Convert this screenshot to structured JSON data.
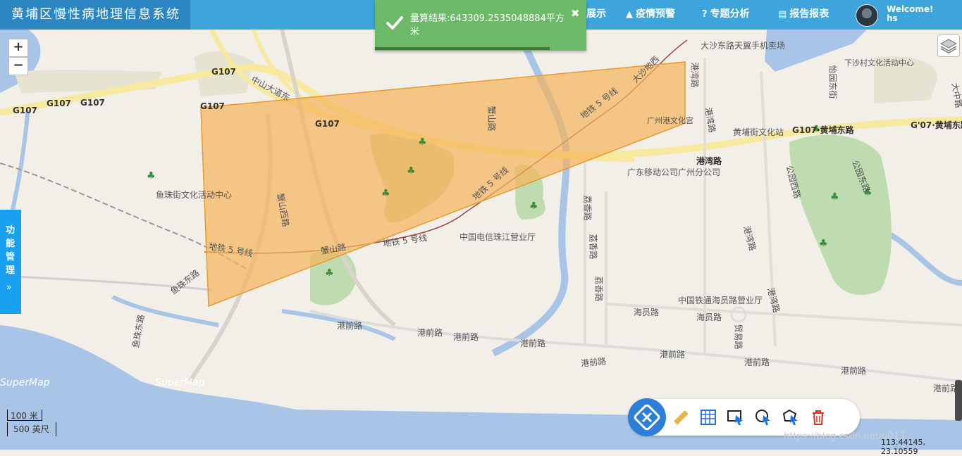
{
  "app": {
    "title": "黄埔区慢性病地理信息系统"
  },
  "nav": {
    "items": [
      {
        "label": "展示",
        "icon": "map-icon"
      },
      {
        "label": "疫情预警",
        "icon": "warning-icon"
      },
      {
        "label": "专题分析",
        "icon": "question-circle-icon"
      },
      {
        "label": "报告报表",
        "icon": "list-icon"
      }
    ],
    "welcome": "Welcome!",
    "user": "hs"
  },
  "notification": {
    "message": "量算结果:643309.2535048884平方米"
  },
  "side_panel": {
    "label": "功能管理",
    "arrow": "»"
  },
  "scale": {
    "metric": "100 米",
    "imperial": "500 英尺"
  },
  "status": {
    "coordinates": "113.44145, 23.10559",
    "watermark": "https://blog.csdn.net/u013..."
  },
  "map_labels": {
    "g107_a": "G107",
    "g107_b": "G107",
    "g107_c": "G107",
    "g107_d": "G107",
    "g107_e": "G107",
    "g107_f": "G107",
    "g107_huangpu": "G'07·黄埔东路",
    "g107_huangpu2": "G107·黄埔东路",
    "zhongshan": "中山大道东",
    "xieshan": "蟹山路",
    "xieshan_west": "蟹山西路",
    "xieshan2": "蟹山路",
    "metro5_a": "地铁 5 号线",
    "metro5_b": "地铁 5 号线",
    "metro5_c": "地铁 5 号线",
    "metro5_d": "地铁 5 号线",
    "dashaxi": "大沙地西",
    "gangwan": "港湾路",
    "gangwan2": "港湾路",
    "gangwan3": "港湾路",
    "gangwan4": "港湾路",
    "gangwan5": "港湾路",
    "lixiang": "荔香路",
    "lixiang2": "荔香路",
    "lixiang3": "荔香路",
    "yuzhu_center": "鱼珠街文化活动中心",
    "yuzhu_east": "鱼珠东路",
    "yuzhu_east2": "鱼珠东路",
    "gangqian_a": "港前路",
    "gangqian_b": "港前路",
    "gangqian_c": "港前路",
    "gangqian_d": "港前路",
    "gangqian_e": "港前路",
    "gangqian_f": "港前路",
    "gangqian_g": "港前路",
    "gangqian_h": "港前路",
    "gangqian_i": "港前路",
    "haiyuan": "海员路",
    "haiyuan2": "海员路",
    "maoyi": "贸易路",
    "mobile": "广东移动公司广州分公司",
    "telecom": "中国电信珠江营业厅",
    "tietong": "中国铁通海员路营业厅",
    "port_palace": "广州港文化宫",
    "huangpu_station": "黄埔街文化站",
    "phone_shop": "大沙东路天翼手机卖场",
    "xiasha": "下沙村文化活动中心",
    "yiyuan": "怡园东街",
    "park_west": "公园西路",
    "park_east": "公园东路",
    "zhongshan_right": "大中路",
    "supermap1": "SuperMap",
    "supermap2": "SuperMap"
  }
}
